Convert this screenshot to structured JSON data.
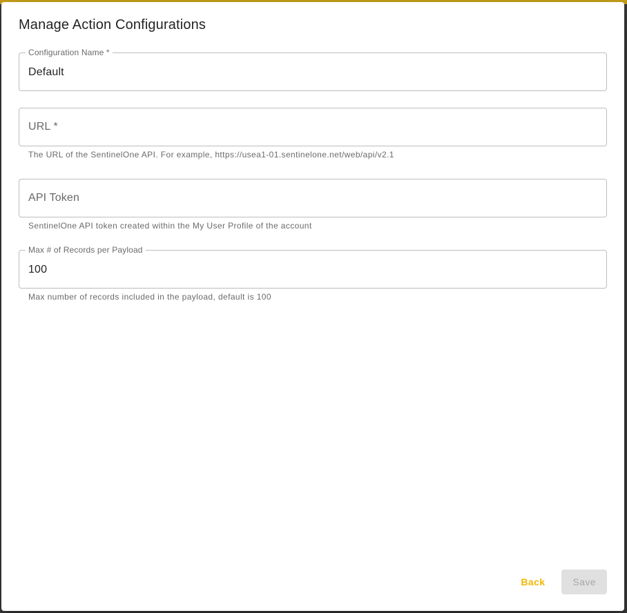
{
  "dialog": {
    "title": "Manage Action Configurations"
  },
  "fields": {
    "config_name": {
      "label": "Configuration Name *",
      "value": "Default"
    },
    "url": {
      "label": "URL *",
      "value": "",
      "helper": "The URL of the SentinelOne API. For example, https://usea1-01.sentinelone.net/web/api/v2.1"
    },
    "api_token": {
      "label": "API Token",
      "value": "",
      "helper": "SentinelOne API token created within the My User Profile of the account"
    },
    "max_records": {
      "label": "Max # of Records per Payload",
      "value": "100",
      "helper": "Max number of records included in the payload, default is 100"
    }
  },
  "actions": {
    "back_label": "Back",
    "save_label": "Save"
  },
  "colors": {
    "accent": "#f2b705",
    "disabled_bg": "#e0e0e0"
  }
}
